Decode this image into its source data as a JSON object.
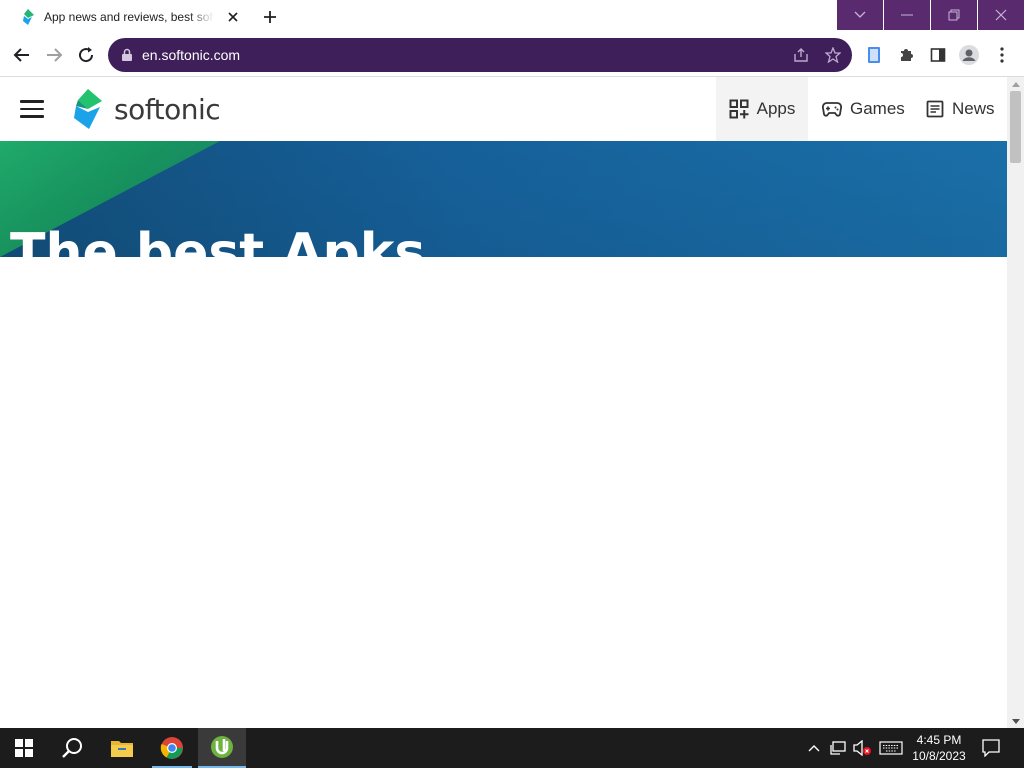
{
  "browser": {
    "tab": {
      "title": "App news and reviews, best software downloads and discovery - Softonic"
    },
    "url": "en.softonic.com",
    "theme_color": "#3f1f5a",
    "window_control_color": "#5a2a6e"
  },
  "site": {
    "logo_text": "softonic",
    "nav": [
      {
        "label": "Apps",
        "icon": "apps-grid-icon",
        "active": true
      },
      {
        "label": "Games",
        "icon": "gamepad-icon",
        "active": false
      },
      {
        "label": "News",
        "icon": "newspaper-icon",
        "active": false
      }
    ],
    "hero": {
      "title": "The best Apks"
    }
  },
  "taskbar": {
    "apps": [
      "start-icon",
      "search-icon",
      "file-explorer-icon",
      "chrome-icon",
      "utorrent-icon"
    ],
    "clock": {
      "time": "4:45 PM",
      "date": "10/8/2023"
    }
  }
}
